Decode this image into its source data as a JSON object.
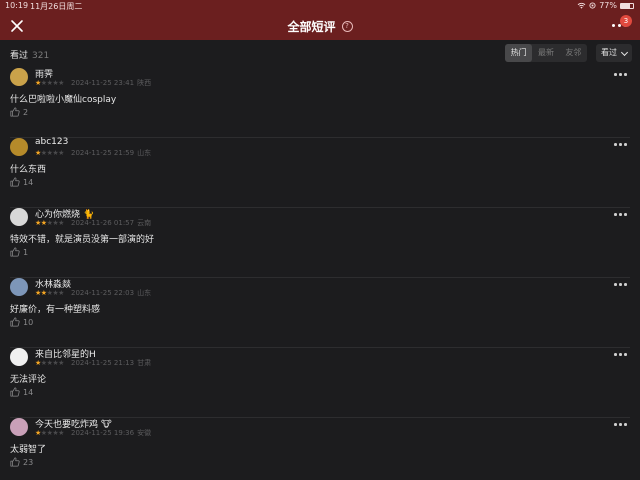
{
  "status_bar": {
    "time": "10:19",
    "date": "11月26日周二",
    "battery": "77%",
    "battery_level": 0.77
  },
  "header": {
    "title": "全部短评",
    "help_glyph": "?",
    "notification_count": "3"
  },
  "filter": {
    "count_label": "看过",
    "count_value": "321",
    "tabs": [
      "热门",
      "最新",
      "友邻"
    ],
    "active_tab": 0,
    "viewed_label": "看过"
  },
  "comments": [
    {
      "user": "雨霁",
      "emoji": "",
      "rating": 1,
      "date": "2024-11-25 23:41",
      "location": "陕西",
      "text": "什么巴啦啦小魔仙cosplay",
      "likes": "2",
      "avatar_color": "#caa24a"
    },
    {
      "user": "abc123",
      "emoji": "",
      "rating": 1,
      "date": "2024-11-25 21:59",
      "location": "山东",
      "text": "什么东西",
      "likes": "14",
      "avatar_color": "#b58a2a"
    },
    {
      "user": "心为你燃烧",
      "emoji": "🐈",
      "rating": 2,
      "date": "2024-11-26 01:57",
      "location": "云南",
      "text": "特效不错，就是演员没第一部演的好",
      "likes": "1",
      "avatar_color": "#d8d8d8"
    },
    {
      "user": "水林淼燚",
      "emoji": "",
      "rating": 2,
      "date": "2024-11-25 22:03",
      "location": "山东",
      "text": "好廉价，有一种塑料感",
      "likes": "10",
      "avatar_color": "#7d96b8"
    },
    {
      "user": "来自比邻星的H",
      "emoji": "",
      "rating": 1,
      "date": "2024-11-25 21:13",
      "location": "甘肃",
      "text": "无法评论",
      "likes": "14",
      "avatar_color": "#f0f0f0"
    },
    {
      "user": "今天也要吃炸鸡",
      "emoji": "🐮",
      "rating": 1,
      "date": "2024-11-25 19:36",
      "location": "安徽",
      "text": "太弱智了",
      "likes": "23",
      "avatar_color": "#c9a0b8"
    }
  ],
  "colors": {
    "header_bg": "#6b1f1f",
    "page_bg": "#1c1c1e",
    "star_active": "#f5a623",
    "star_inactive": "#4a4a4c"
  }
}
